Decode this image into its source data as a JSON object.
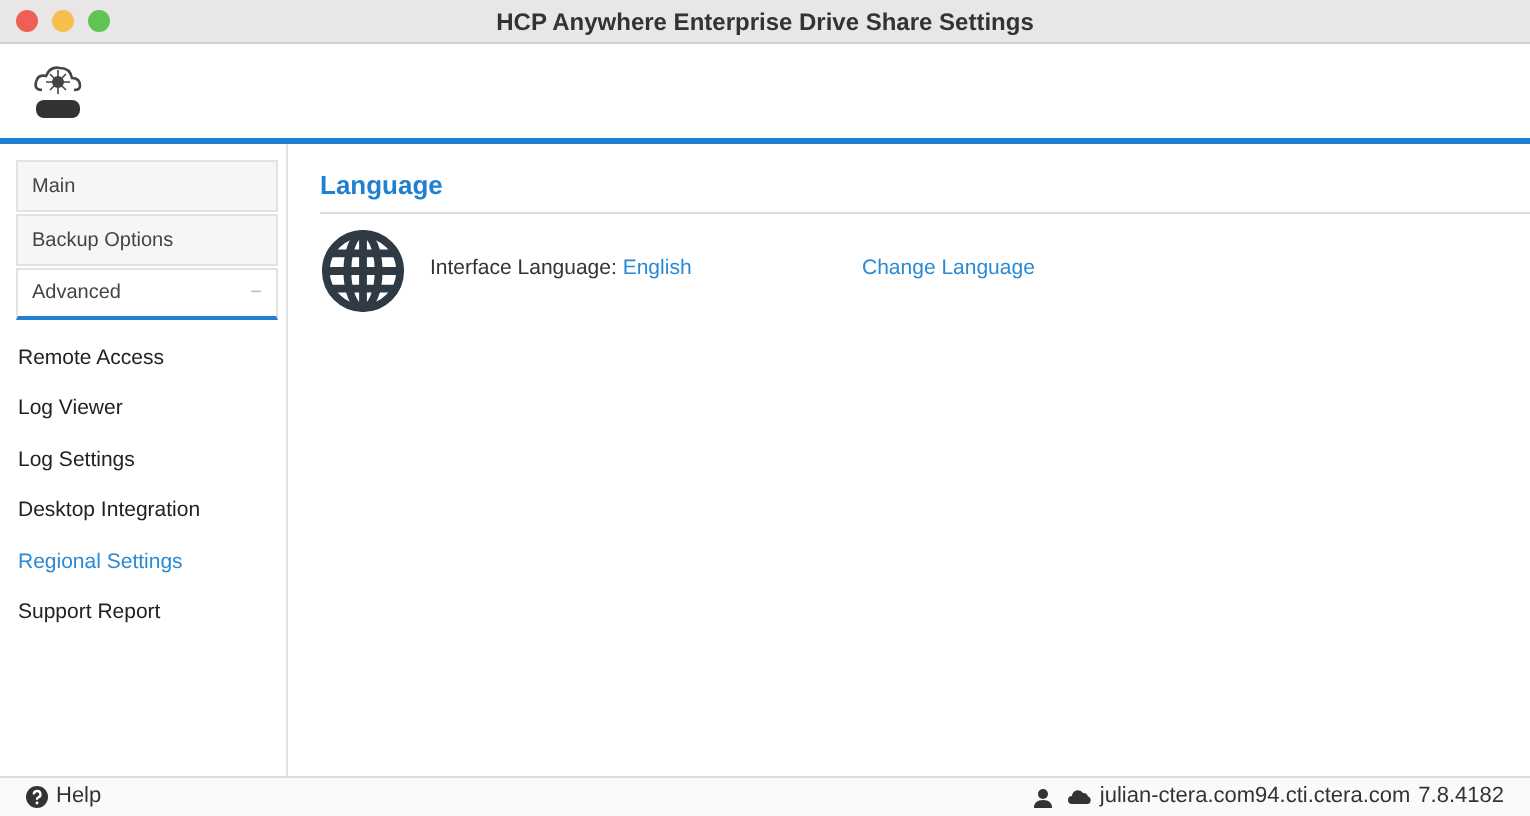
{
  "window": {
    "title": "HCP Anywhere Enterprise Drive Share Settings"
  },
  "sidebar": {
    "sections": [
      {
        "label": "Main",
        "expanded": false
      },
      {
        "label": "Backup Options",
        "expanded": false
      },
      {
        "label": "Advanced",
        "expanded": true,
        "toggle": "−"
      }
    ],
    "items": [
      {
        "label": "Remote Access",
        "selected": false
      },
      {
        "label": "Log Viewer",
        "selected": false
      },
      {
        "label": "Log Settings",
        "selected": false
      },
      {
        "label": "Desktop Integration",
        "selected": false
      },
      {
        "label": "Regional Settings",
        "selected": true
      },
      {
        "label": "Support Report",
        "selected": false
      }
    ]
  },
  "content": {
    "heading": "Language",
    "label": "Interface Language:",
    "value": "English",
    "action": "Change Language"
  },
  "status_bar": {
    "help": "Help",
    "server": "julian-ctera.com94.cti.ctera.com",
    "version": "7.8.4182"
  }
}
